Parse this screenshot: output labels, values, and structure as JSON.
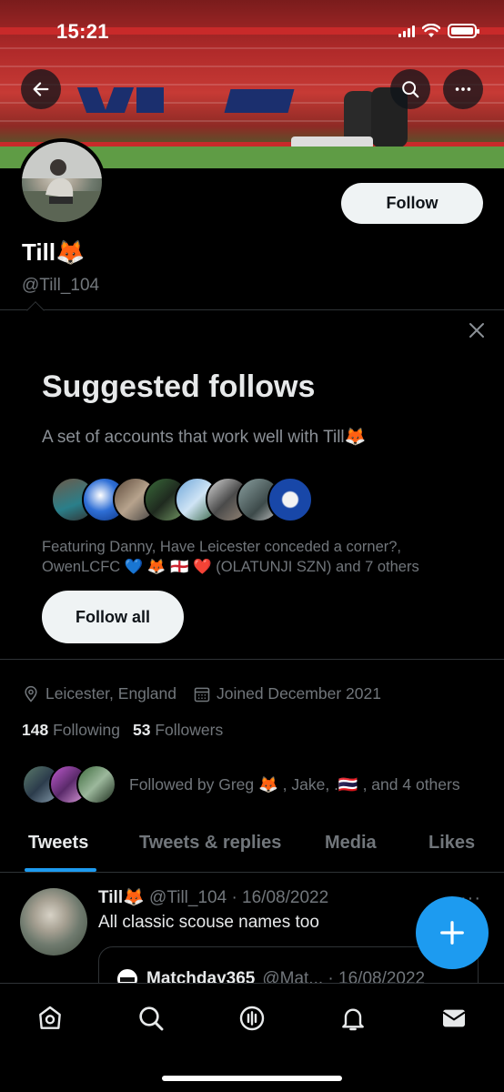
{
  "status_bar": {
    "time": "15:21"
  },
  "profile": {
    "name": "Till🦊",
    "handle": "@Till_104",
    "follow_label": "Follow"
  },
  "suggested": {
    "title": "Suggested follows",
    "subtitle": "A set of accounts that work well with Till🦊",
    "featuring_line1": "Featuring Danny, Have Leicester conceded a corner?,",
    "featuring_line2_a": "OwenLCFC ",
    "featuring_line2_b": "💙",
    "featuring_line2_c": " 🦊 🏴󠁧󠁢󠁥󠁮󠁧󠁿 ",
    "featuring_line2_d": "❤️",
    "featuring_line2_e": " (OLATUNJI SZN) and 7 others",
    "follow_all_label": "Follow all"
  },
  "meta": {
    "location": "Leicester, England",
    "joined": "Joined December 2021",
    "following_count": "148",
    "following_label": "Following",
    "followers_count": "53",
    "followers_label": "Followers",
    "followed_by": "Followed by Greg 🦊 , Jake, .🇹🇭 , and 4 others"
  },
  "tabs": [
    "Tweets",
    "Tweets & replies",
    "Media",
    "Likes"
  ],
  "tweet": {
    "author": "Till🦊",
    "handle_date": "@Till_104 · 16/08/2022",
    "text": "All classic scouse names too",
    "more": "···",
    "quote_author": "Matchday365",
    "quote_handle_date": "@Mat... · 16/08/2022"
  },
  "colors": {
    "accent": "#1d9bf0",
    "background": "#000000",
    "secondary_text": "#71767b"
  },
  "icons": {
    "back": "arrow-left-icon",
    "search": "search-icon",
    "more": "more-horizontal-icon",
    "close": "close-icon",
    "location": "location-pin-icon",
    "calendar": "calendar-icon",
    "compose": "plus-icon",
    "nav": [
      "home-icon",
      "search-icon",
      "spaces-icon",
      "bell-icon",
      "mail-icon"
    ]
  }
}
